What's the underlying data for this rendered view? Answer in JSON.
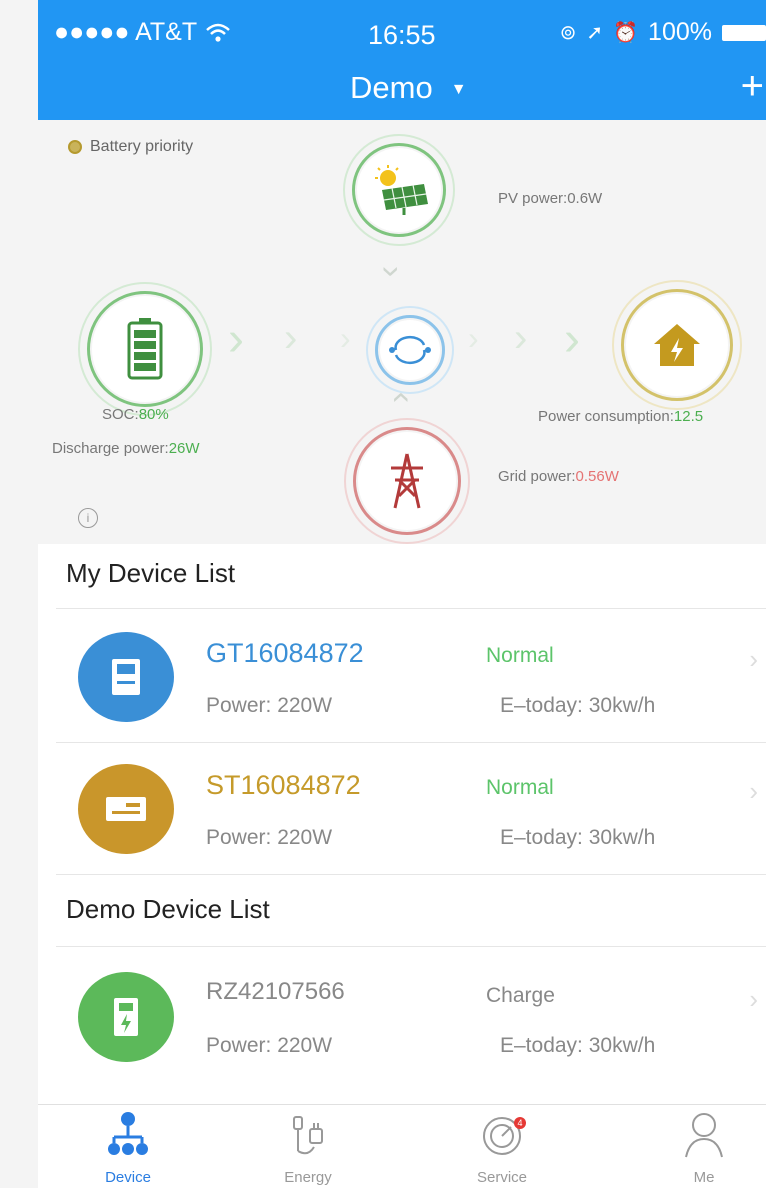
{
  "status_bar": {
    "carrier": "●●●●● AT&T",
    "time": "16:55",
    "battery": "100%"
  },
  "nav": {
    "title": "Demo"
  },
  "flow": {
    "mode": "Battery priority",
    "pv": {
      "label": "PV power:",
      "value": "0.6W"
    },
    "soc": {
      "label": "SOC:",
      "value": "80%"
    },
    "discharge": {
      "label": "Discharge power:",
      "value": "26W"
    },
    "consumption": {
      "label": "Power consumption:",
      "value": "12.5"
    },
    "grid": {
      "label": "Grid power:",
      "value": "0.56W"
    }
  },
  "my_devices": {
    "title": "My Device List",
    "items": [
      {
        "name": "GT16084872",
        "status": "Normal",
        "power": "Power: 220W",
        "etoday": "E–today: 30kw/h",
        "name_color": "#3a8fd6",
        "status_color": "#5cc46a",
        "icon_color": "#3a8fd6"
      },
      {
        "name": "ST16084872",
        "status": "Normal",
        "power": "Power: 220W",
        "etoday": "E–today: 30kw/h",
        "name_color": "#c59a2a",
        "status_color": "#5cc46a",
        "icon_color": "#c9962b"
      }
    ]
  },
  "demo_devices": {
    "title": "Demo Device List",
    "items": [
      {
        "name": "RZ42107566",
        "status": "Charge",
        "power": "Power: 220W",
        "etoday": "E–today: 30kw/h",
        "name_color": "#888888",
        "status_color": "#888888",
        "icon_color": "#5cb95a"
      }
    ]
  },
  "tabs": [
    {
      "label": "Device",
      "icon": "device-tree-icon",
      "active": true
    },
    {
      "label": "Energy",
      "icon": "energy-plug-icon",
      "active": false
    },
    {
      "label": "Service",
      "icon": "service-dial-icon",
      "active": false,
      "badge": "4"
    },
    {
      "label": "Me",
      "icon": "person-icon",
      "active": false
    }
  ],
  "colors": {
    "accent": "#2196f3",
    "tab_active": "#2a7de1"
  }
}
